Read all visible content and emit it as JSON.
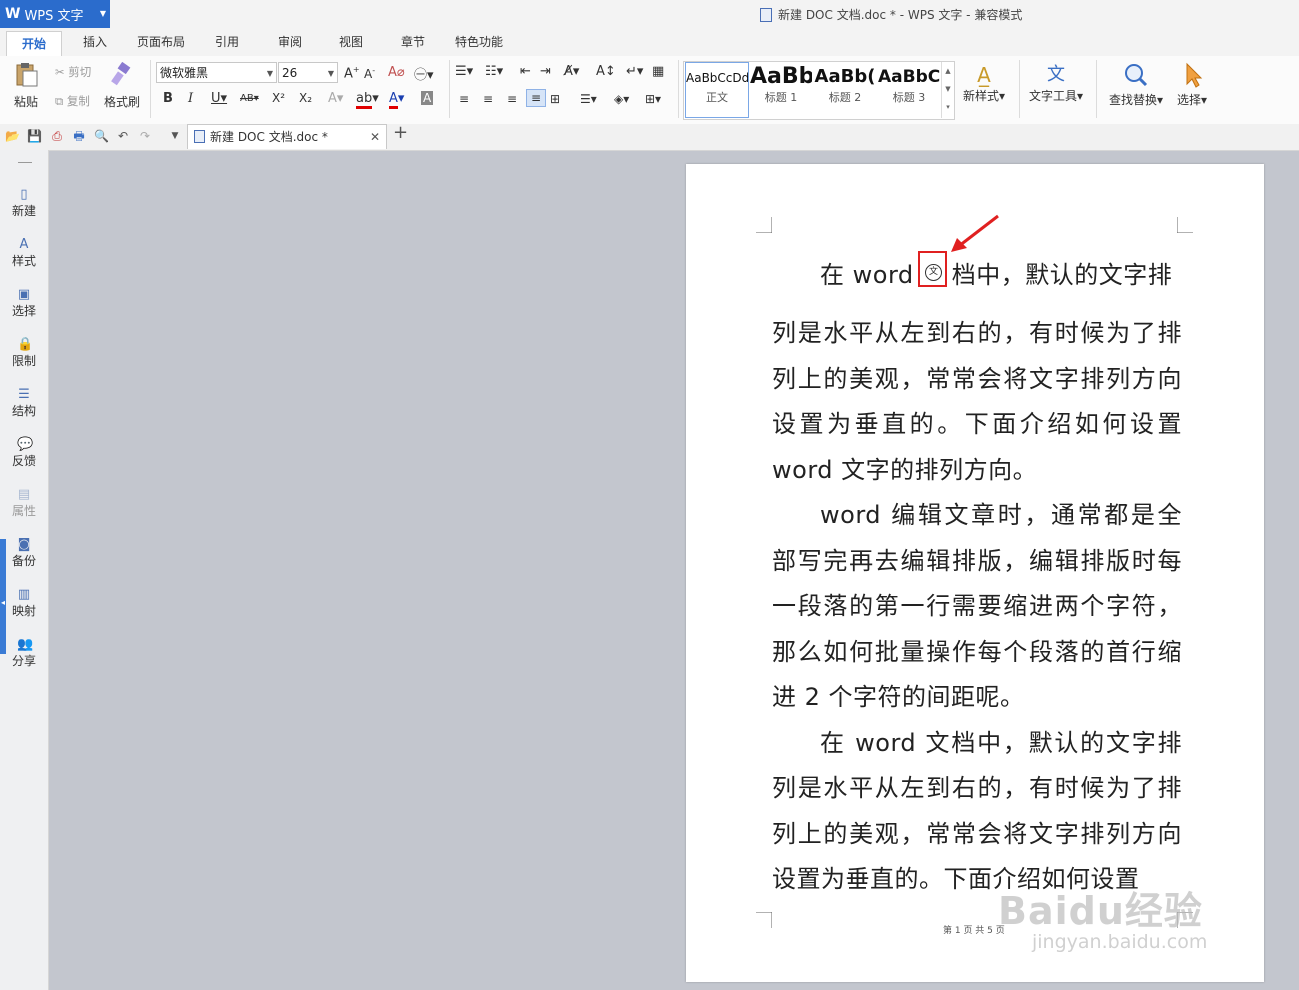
{
  "app": {
    "name": "WPS 文字"
  },
  "window": {
    "title": "新建 DOC 文档.doc * - WPS 文字 - 兼容模式"
  },
  "menu_tabs": [
    "开始",
    "插入",
    "页面布局",
    "引用",
    "审阅",
    "视图",
    "章节",
    "特色功能"
  ],
  "ribbon": {
    "paste": "粘贴",
    "cut": "剪切",
    "copy": "复制",
    "format_painter": "格式刷",
    "font_name": "微软雅黑",
    "font_size": "26",
    "bold": "B",
    "italic": "I",
    "underline": "U",
    "strikethrough": "AB",
    "superscript": "X²",
    "subscript": "X₂",
    "styles": [
      {
        "sample": "AaBbCcDd",
        "name": "正文"
      },
      {
        "sample": "AaBb",
        "name": "标题 1"
      },
      {
        "sample": "AaBb(",
        "name": "标题 2"
      },
      {
        "sample": "AaBbC",
        "name": "标题 3"
      }
    ],
    "new_style": "新样式",
    "text_tools": "文字工具",
    "find_replace": "查找替换",
    "select": "选择"
  },
  "document_tab": {
    "title": "新建 DOC 文档.doc *"
  },
  "sidebar": [
    "新建",
    "样式",
    "选择",
    "限制",
    "结构",
    "反馈",
    "属性",
    "备份",
    "映射",
    "分享"
  ],
  "document": {
    "para1_line1_before": "在 word ",
    "para1_vertical_char": "文",
    "para1_line1_after": "档中，默认的文字排",
    "para1_rest": "列是水平从左到右的，有时候为了排列上的美观，常常会将文字排列方向设置为垂直的。下面介绍如何设置 word 文字的排列方向。",
    "para2": "word 编辑文章时，通常都是全部写完再去编辑排版，编辑排版时每一段落的第一行需要缩进两个字符，那么如何批量操作每个段落的首行缩进 2 个字符的间距呢。",
    "para3": "在 word 文档中，默认的文字排列是水平从左到右的，有时候为了排列上的美观，常常会将文字排列方向设置为垂直的。下面介绍如何设置",
    "page_footer": "第 1 页 共 5 页"
  },
  "watermark": {
    "main": "Baidu经验",
    "sub": "jingyan.baidu.com"
  },
  "colors": {
    "accent": "#2b6ccc",
    "highlight": "#e02020"
  }
}
